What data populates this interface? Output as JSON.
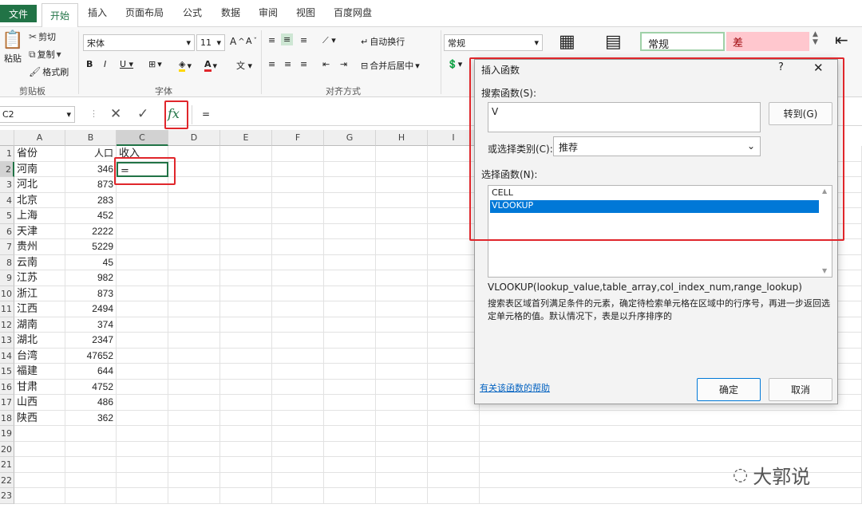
{
  "tabs": {
    "file": "文件",
    "items": [
      "开始",
      "插入",
      "页面布局",
      "公式",
      "数据",
      "审阅",
      "视图",
      "百度网盘"
    ]
  },
  "ribbon": {
    "paste": "粘贴",
    "cut": "剪切",
    "copy": "复制",
    "format_painter": "格式刷",
    "clipboard_group": "剪贴板",
    "font_name": "宋体",
    "font_size": "11",
    "font_group": "字体",
    "wrap_text": "自动换行",
    "merge_center": "合并后居中",
    "alignment_group": "对齐方式",
    "number_format": "常规",
    "style_normal": "常规",
    "style_bad": "差"
  },
  "formula_bar": {
    "name_box": "C2",
    "fx": "fx",
    "content": "="
  },
  "grid": {
    "columns": [
      "A",
      "B",
      "C",
      "D",
      "E",
      "F",
      "G",
      "H",
      "I"
    ],
    "rows": [
      "1",
      "2",
      "3",
      "4",
      "5",
      "6",
      "7",
      "8",
      "9",
      "10",
      "11",
      "12",
      "13",
      "14",
      "15",
      "16",
      "17",
      "18",
      "19",
      "20",
      "21",
      "22",
      "23"
    ],
    "header": {
      "a": "省份",
      "b": "人口",
      "c": "收入"
    },
    "data": [
      {
        "a": "河南",
        "b": "346",
        "c": "="
      },
      {
        "a": "河北",
        "b": "873"
      },
      {
        "a": "北京",
        "b": "283"
      },
      {
        "a": "上海",
        "b": "452"
      },
      {
        "a": "天津",
        "b": "2222"
      },
      {
        "a": "贵州",
        "b": "5229"
      },
      {
        "a": "云南",
        "b": "45"
      },
      {
        "a": "江苏",
        "b": "982"
      },
      {
        "a": "浙江",
        "b": "873"
      },
      {
        "a": "江西",
        "b": "2494"
      },
      {
        "a": "湖南",
        "b": "374"
      },
      {
        "a": "湖北",
        "b": "2347"
      },
      {
        "a": "台湾",
        "b": "47652"
      },
      {
        "a": "福建",
        "b": "644"
      },
      {
        "a": "甘肃",
        "b": "4752"
      },
      {
        "a": "山西",
        "b": "486"
      },
      {
        "a": "陕西",
        "b": "362"
      }
    ]
  },
  "dialog": {
    "title": "插入函数",
    "help": "?",
    "close": "✕",
    "search_label": "搜索函数(S):",
    "search_value": "V",
    "go_button": "转到(G)",
    "category_label": "或选择类别(C):",
    "category_value": "推荐",
    "select_label": "选择函数(N):",
    "functions": [
      "CELL",
      "VLOOKUP"
    ],
    "signature": "VLOOKUP(lookup_value,table_array,col_index_num,range_lookup)",
    "description": "搜索表区域首列满足条件的元素，确定待检索单元格在区域中的行序号，再进一步返回选定单元格的值。默认情况下，表是以升序排序的",
    "help_link": "有关该函数的帮助",
    "ok": "确定",
    "cancel": "取消"
  },
  "watermark": "大郭说",
  "colors": {
    "accent": "#217346",
    "highlight_red": "#e0262b",
    "selection": "#0078d7"
  }
}
